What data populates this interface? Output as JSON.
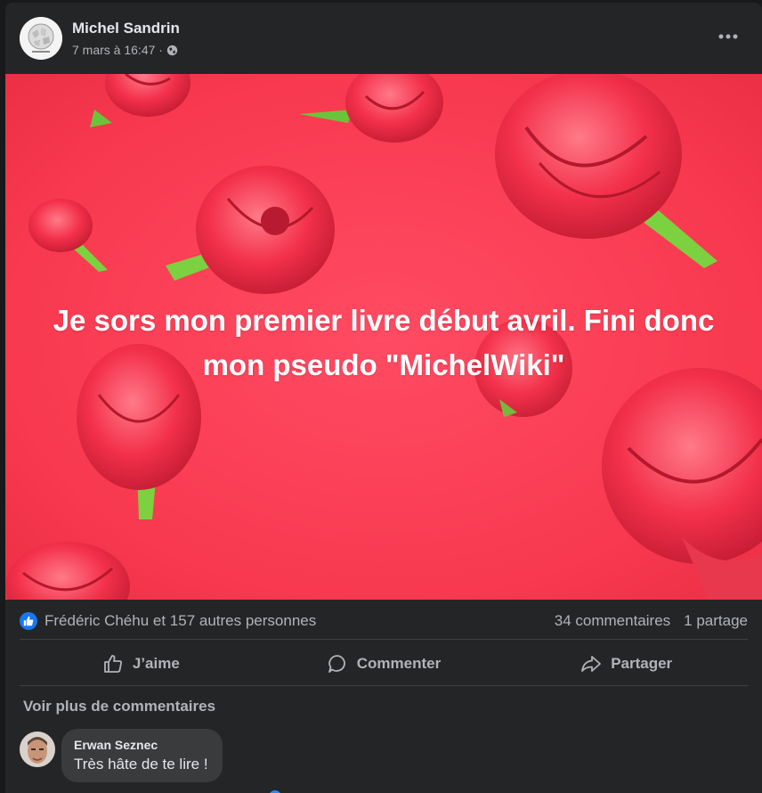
{
  "post": {
    "author": "Michel Sandrin",
    "timestamp": "7 mars à 16:47 ·",
    "privacy_icon": "globe-icon",
    "image_text": "Je sors mon premier livre début avril. Fini donc mon pseudo \"MichelWiki\""
  },
  "stats": {
    "reactions": "Frédéric Chéhu et 157 autres personnes",
    "comments": "34 commentaires",
    "shares": "1 partage"
  },
  "actions": {
    "like": "J’aime",
    "comment": "Commenter",
    "share": "Partager"
  },
  "comments": {
    "see_more": "Voir plus de commentaires",
    "items": [
      {
        "author": "Erwan Seznec",
        "text": "Très hâte de te lire !"
      }
    ]
  },
  "colors": {
    "background": "#18191a",
    "card": "#242526",
    "banner": "#f8394f",
    "accent": "#1877f2",
    "text_secondary": "#b0b3b8"
  }
}
